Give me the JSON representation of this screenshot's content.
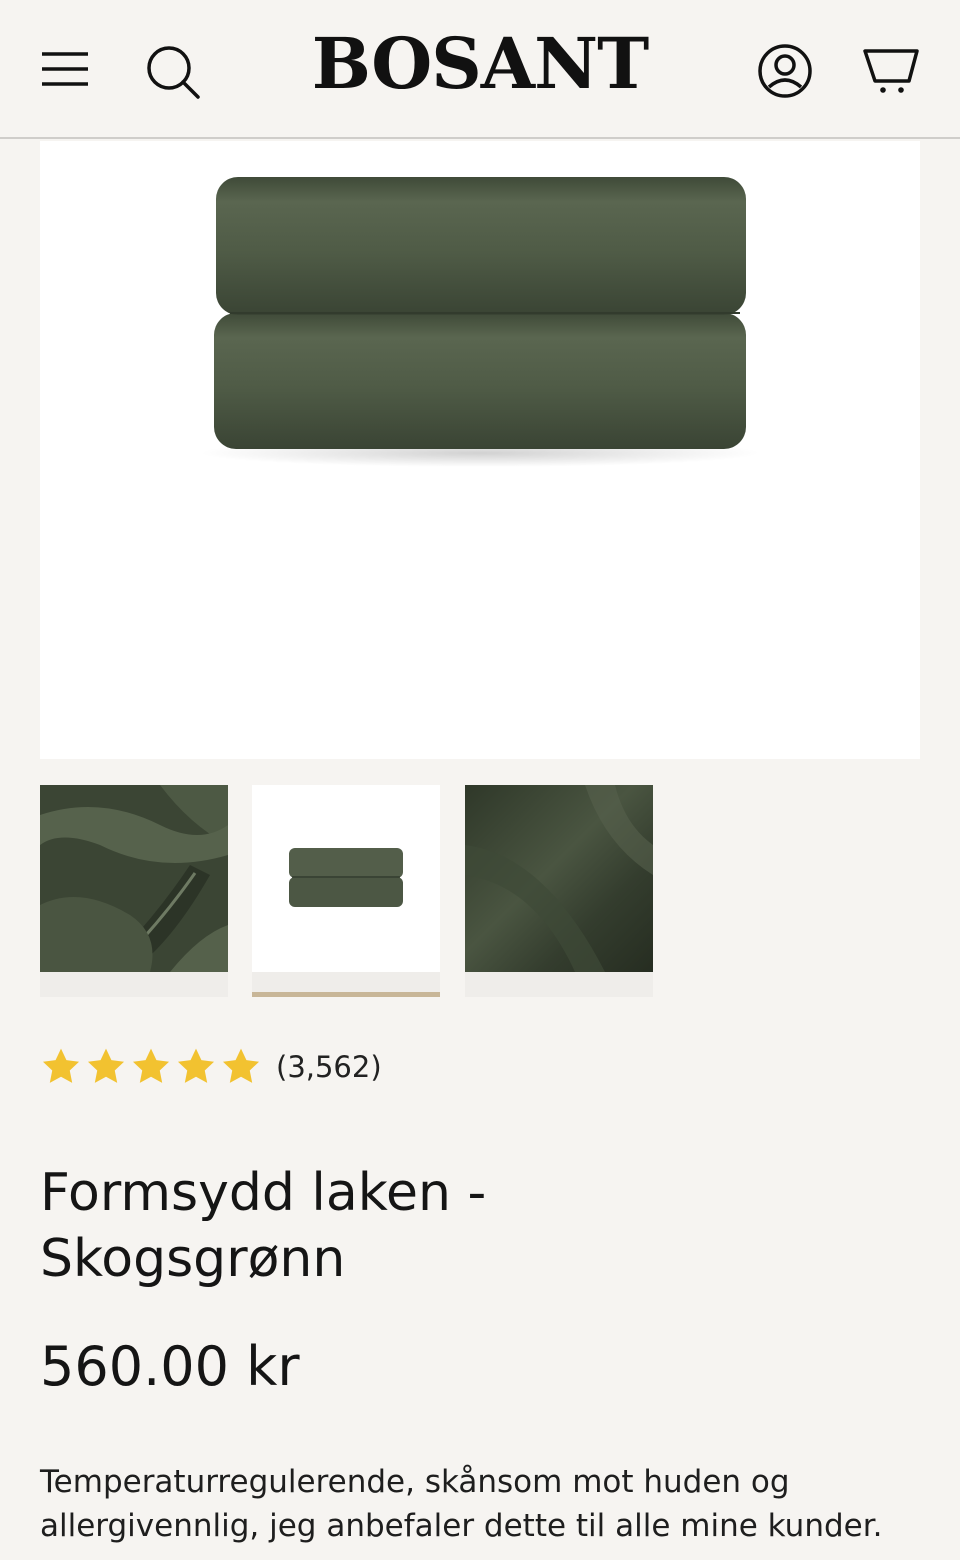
{
  "header": {
    "logo": "BOSANT",
    "icons": [
      "menu-icon",
      "search-icon",
      "account-icon",
      "cart-icon"
    ]
  },
  "product": {
    "image_alt": "Formsydd laken - Skogsgrønn",
    "color": "#4e5946",
    "thumbnails": [
      {
        "name": "thumb-fitted-corner",
        "active": false
      },
      {
        "name": "thumb-folded-sheets",
        "active": true
      },
      {
        "name": "thumb-fabric-closeup",
        "active": false
      }
    ],
    "rating": {
      "stars": 5,
      "max": 5,
      "count": "(3,562)",
      "star_color": "#f2c230"
    },
    "title_line1": "Formsydd laken -",
    "title_line2": "Skogsgrønn",
    "price": "560.00 kr",
    "description": "Temperaturregulerende, skånsom mot huden og allergivennlig, jeg anbefaler dette til alle mine kunder."
  }
}
